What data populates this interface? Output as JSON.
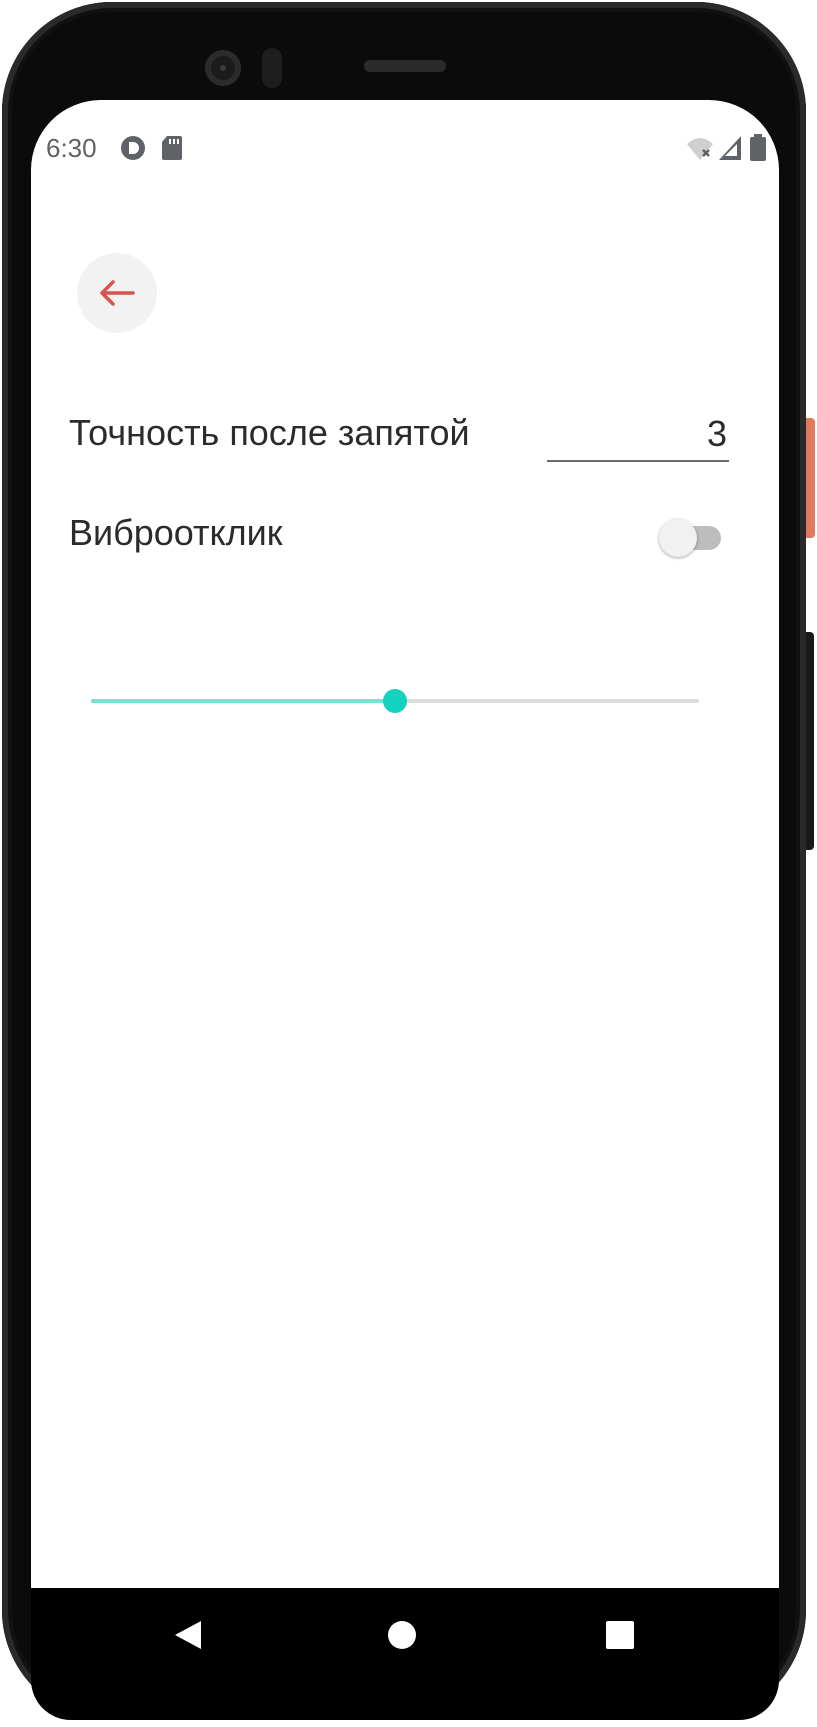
{
  "status_bar": {
    "time": "6:30",
    "left_icons": [
      "data-saver-icon",
      "sd-card-icon"
    ],
    "right_icons": [
      "wifi-off-icon",
      "cell-signal-icon",
      "battery-icon"
    ]
  },
  "header": {
    "back_icon": "arrow-left-icon",
    "accent_color": "#d9534f"
  },
  "settings": {
    "precision_label": "Точность после запятой",
    "precision_value": "3",
    "vibration_label": "Виброотклик",
    "vibration_enabled": false,
    "slider_fraction": 0.5,
    "slider_color": "#14d1c0"
  },
  "nav_bar": {
    "buttons": [
      "back-triangle-icon",
      "home-circle-icon",
      "recents-square-icon"
    ]
  }
}
